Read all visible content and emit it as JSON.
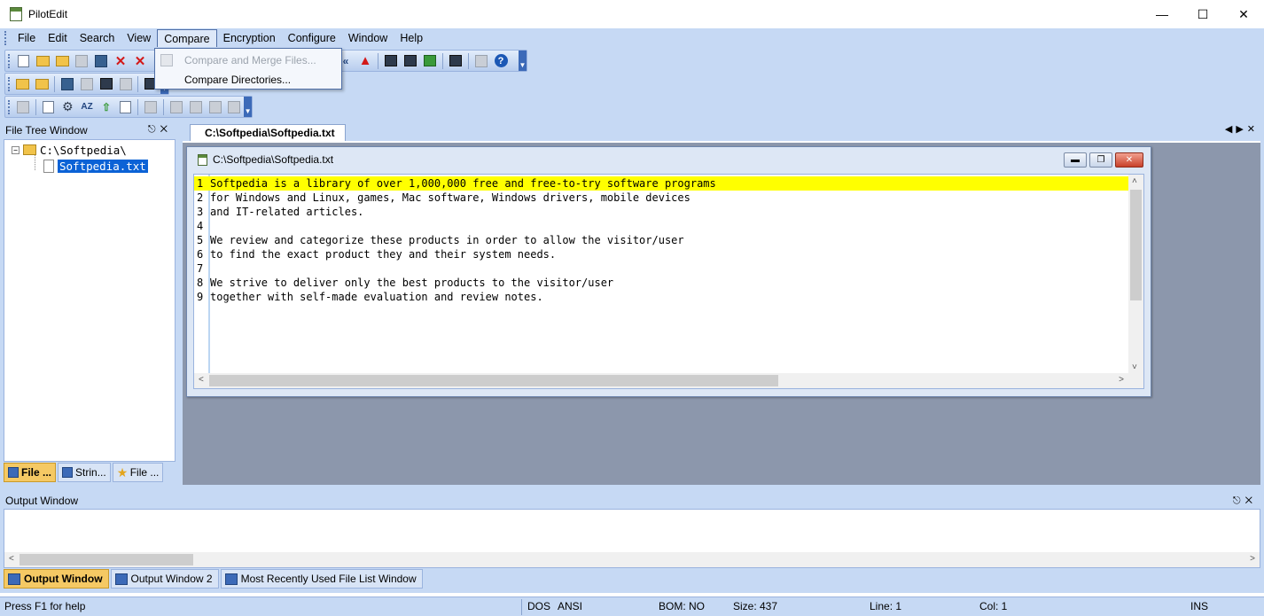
{
  "window": {
    "title": "PilotEdit"
  },
  "menubar": {
    "items": [
      {
        "label": "File"
      },
      {
        "label": "Edit"
      },
      {
        "label": "Search"
      },
      {
        "label": "View"
      },
      {
        "label": "Compare"
      },
      {
        "label": "Encryption"
      },
      {
        "label": "Configure"
      },
      {
        "label": "Window"
      },
      {
        "label": "Help"
      }
    ],
    "open_menu": "Compare"
  },
  "compare_menu": {
    "items": [
      {
        "label": "Compare and Merge Files...",
        "enabled": false
      },
      {
        "label": "Compare Directories...",
        "enabled": true
      }
    ]
  },
  "toolbars": {
    "tb1_icons": [
      "new-file-icon",
      "open-folder-icon",
      "open-remote-icon",
      "save-icon",
      "save-all-icon",
      "close-icon",
      "close-all-icon"
    ],
    "tb1_right_icons": [
      "chevron-left-icon",
      "clear-marks-icon",
      "binoculars-icon",
      "binoculars-red-icon",
      "binoculars-green-icon",
      "find-files-icon",
      "go-to-icon",
      "help-icon"
    ],
    "tb2_icons": [
      "folder-open-icon",
      "folder-star-icon",
      "disk-icon",
      "disk-gray-icon",
      "disk-copy-icon",
      "disk-print-icon",
      "lock-icon"
    ],
    "tb3_icons": [
      "word-wrap-icon",
      "page-setup-icon",
      "settings-icon",
      "sort-az-icon",
      "sort-up-icon",
      "columns-icon",
      "preview-icon",
      "expand-icon",
      "plus-icon",
      "minus-icon",
      "page-icon"
    ]
  },
  "file_tree": {
    "title": "File Tree Window",
    "root": "C:\\Softpedia\\",
    "child": "Softpedia.txt",
    "tabs": [
      {
        "label": "File ...",
        "active": true
      },
      {
        "label": "Strin...",
        "active": false
      },
      {
        "label": "File ...",
        "active": false
      }
    ]
  },
  "document": {
    "tab_label": "C:\\Softpedia\\Softpedia.txt",
    "window_title": "C:\\Softpedia\\Softpedia.txt",
    "lines": [
      {
        "n": "1",
        "text": "Softpedia is a library of over 1,000,000 free and free-to-try software programs"
      },
      {
        "n": "2",
        "text": "for Windows and Linux, games, Mac software, Windows drivers, mobile devices"
      },
      {
        "n": "3",
        "text": "and IT-related articles."
      },
      {
        "n": "4",
        "text": ""
      },
      {
        "n": "5",
        "text": "We review and categorize these products in order to allow the visitor/user"
      },
      {
        "n": "6",
        "text": "to find the exact product they and their system needs."
      },
      {
        "n": "7",
        "text": ""
      },
      {
        "n": "8",
        "text": "We strive to deliver only the best products to the visitor/user"
      },
      {
        "n": "9",
        "text": "together with self-made evaluation and review notes."
      }
    ]
  },
  "output": {
    "title": "Output Window",
    "tabs": [
      {
        "label": "Output Window",
        "active": true
      },
      {
        "label": "Output Window 2",
        "active": false
      },
      {
        "label": "Most Recently Used File List Window",
        "active": false
      }
    ]
  },
  "status": {
    "help": "Press F1 for help",
    "eol": "DOS",
    "encoding": "ANSI",
    "bom": "BOM: NO",
    "size": "Size: 437",
    "line": "Line: 1",
    "col": "Col: 1",
    "mode": "INS"
  },
  "colors": {
    "chrome": "#c6d9f4",
    "highlight_line": "#ffff00",
    "selection": "#0b62d6",
    "active_tab": "#f5c964",
    "mdi_background": "#8c97ac"
  }
}
